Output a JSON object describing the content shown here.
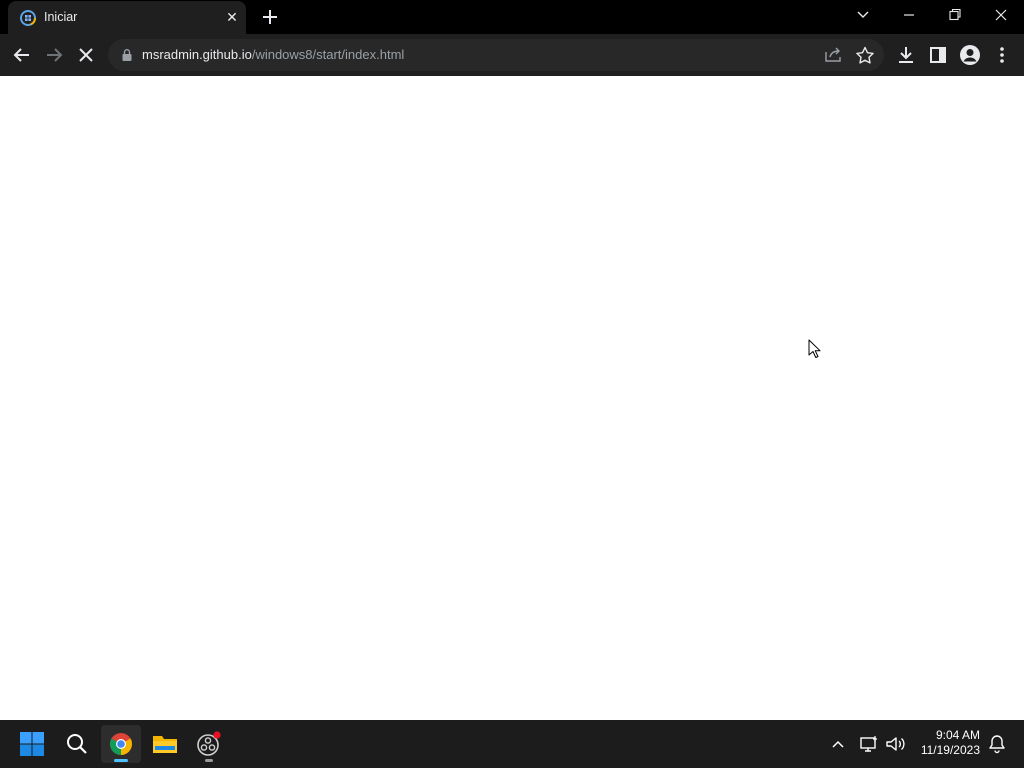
{
  "browser": {
    "tab": {
      "title": "Iniciar",
      "close_glyph": "✕"
    },
    "url": {
      "host": "msradmin.github.io",
      "path": "/windows8/start/index.html"
    },
    "icons": {
      "favicon": "windows-start-favicon-icon",
      "new_tab": "plus-icon",
      "tab_search": "chevron-down-icon",
      "minimize": "minimize-icon",
      "restore": "restore-icon",
      "close": "close-icon",
      "back": "back-arrow-icon",
      "forward": "forward-arrow-icon",
      "stop": "stop-loading-icon",
      "lock": "lock-icon",
      "share": "share-icon",
      "bookmark": "star-icon",
      "download": "download-icon",
      "side_panel": "side-panel-icon",
      "profile": "profile-icon",
      "menu": "kebab-menu-icon"
    }
  },
  "taskbar": {
    "apps": [
      "start",
      "search",
      "chrome",
      "file-explorer",
      "obs-studio"
    ],
    "active_app": "chrome",
    "clock": {
      "time": "9:04 AM",
      "date": "11/19/2023"
    }
  },
  "colors": {
    "titlebar": "#000000",
    "toolbar": "#1f1f1f",
    "omnibox": "#282828",
    "taskbar": "#1c1c1c",
    "accent": "#4cc2ff"
  }
}
